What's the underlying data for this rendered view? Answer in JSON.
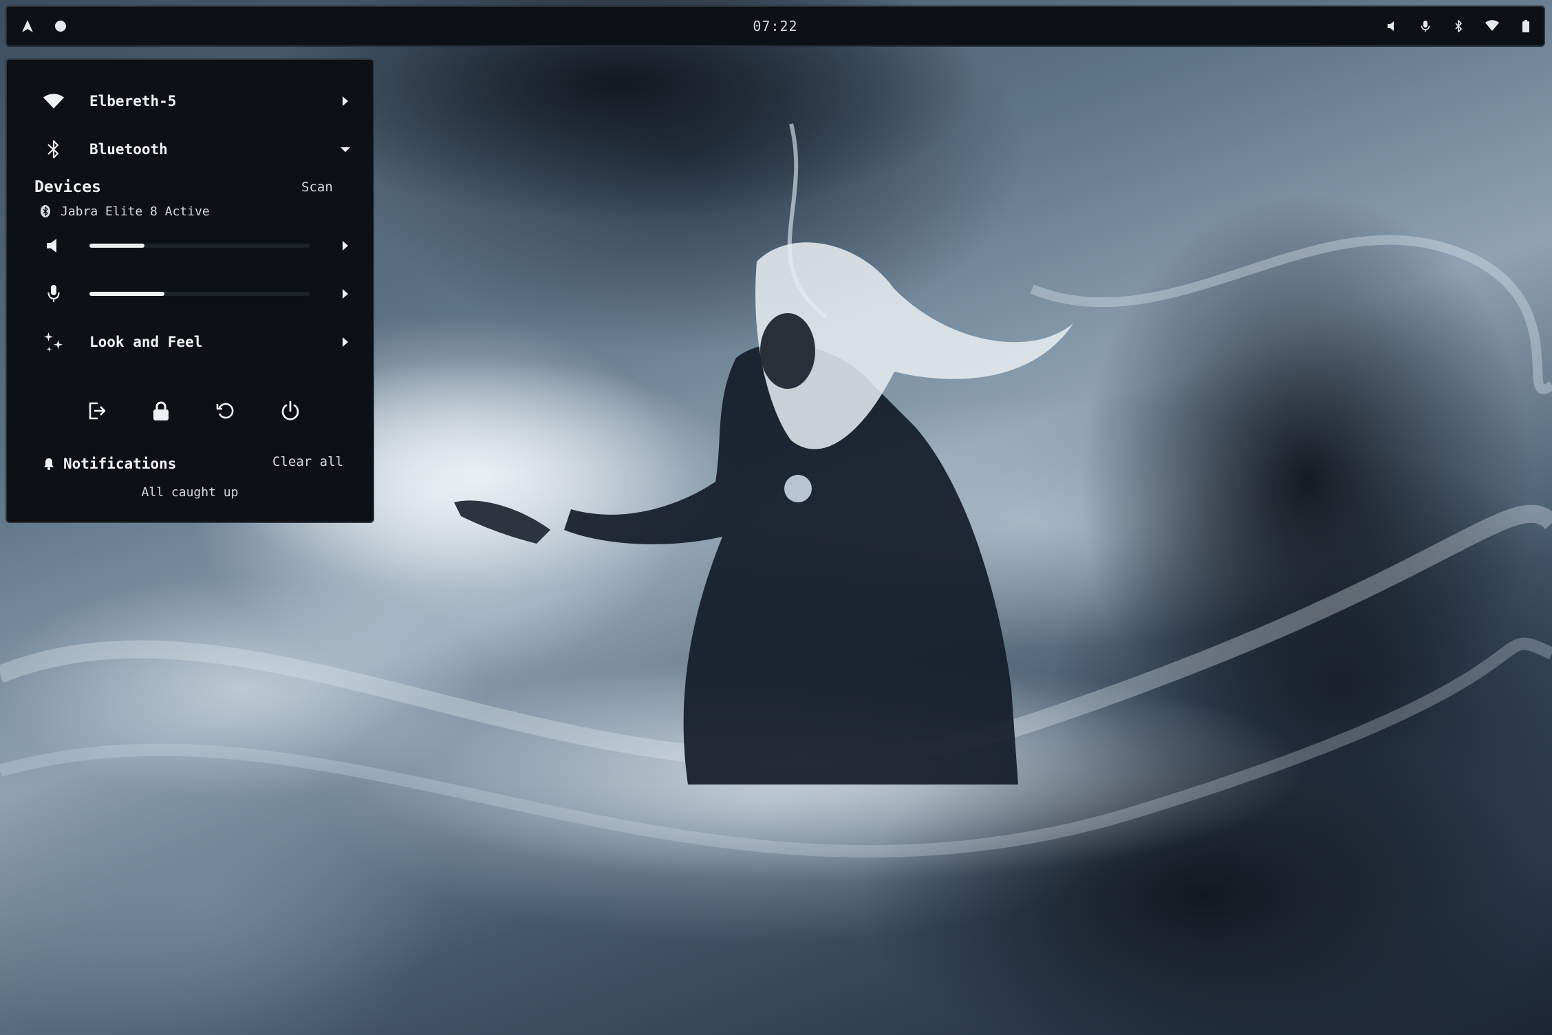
{
  "topbar": {
    "clock": "07:22",
    "left_icons": [
      "arch-logo-icon",
      "circle-indicator-icon"
    ],
    "right_icons": [
      "volume-icon",
      "microphone-icon",
      "bluetooth-icon",
      "wifi-icon",
      "battery-icon"
    ]
  },
  "panel": {
    "wifi": {
      "label": "Elbereth-5",
      "icon": "wifi-icon"
    },
    "bluetooth": {
      "label": "Bluetooth",
      "icon": "bluetooth-icon",
      "expanded": true
    },
    "devices": {
      "header": "Devices",
      "scan_label": "Scan",
      "items": [
        {
          "name": "Jabra Elite 8 Active",
          "icon": "bluetooth-device-icon"
        }
      ]
    },
    "volume": {
      "icon": "volume-icon",
      "level": 0.25
    },
    "microphone": {
      "icon": "microphone-icon",
      "level": 0.34
    },
    "look_and_feel": {
      "label": "Look and Feel",
      "icon": "sparkles-icon"
    },
    "power_actions": [
      "logout-icon",
      "lock-icon",
      "restart-icon",
      "power-icon"
    ],
    "notifications": {
      "header": "Notifications",
      "clear_label": "Clear all",
      "empty_text": "All caught up"
    }
  },
  "colors": {
    "bar_background": "#0d1014",
    "text": "#e6e9ec",
    "accent": "#eef0f2"
  }
}
